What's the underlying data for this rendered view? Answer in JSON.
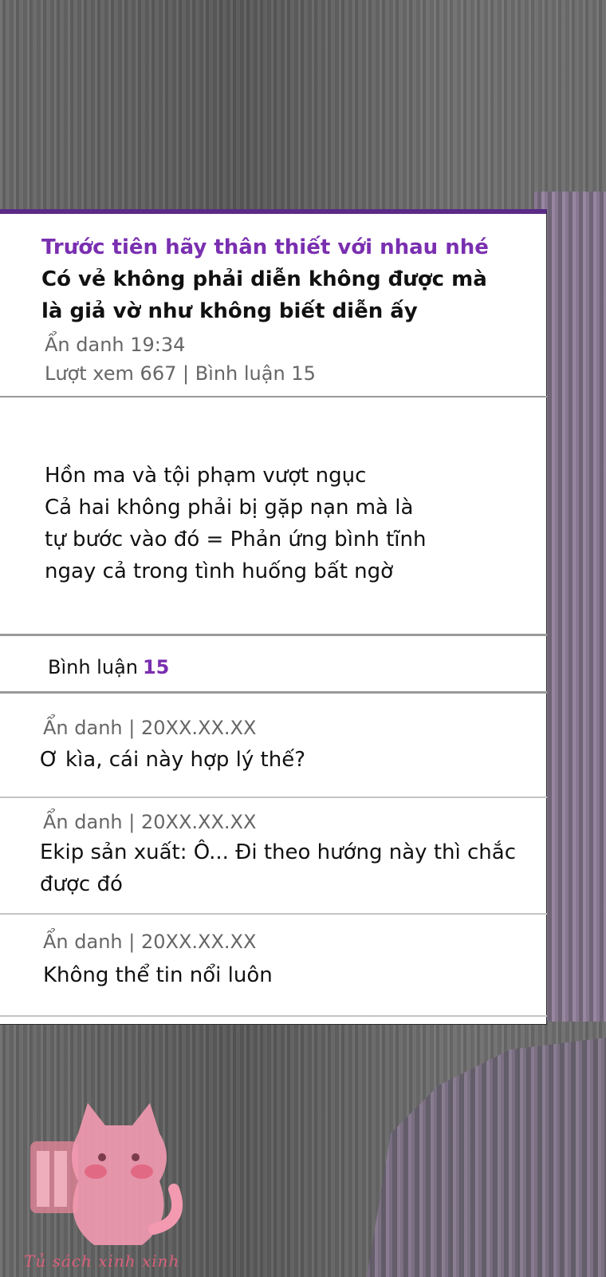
{
  "post": {
    "title_highlight": "Trước tiên hãy thân thiết với nhau nhé",
    "title_rest": " Có vẻ không phải diễn không được mà là giả vờ như không biết diễn ấy",
    "author_time": "Ẩn danh 19:34",
    "stats": "Lượt xem 667 | Bình luận 15",
    "body_lines": [
      "Hồn ma và tội phạm vượt ngục",
      "Cả hai không phải bị gặp nạn mà là",
      "tự bước vào đó = Phản ứng bình tĩnh",
      "ngay cả trong tình huống bất ngờ"
    ]
  },
  "comments": {
    "label": "Bình luận",
    "count": "15",
    "items": [
      {
        "meta": "Ẩn danh | 20XX.XX.XX",
        "text": "Ơ kìa, cái này hợp lý thế?"
      },
      {
        "meta": "Ẩn danh | 20XX.XX.XX",
        "text": "Ekip sản xuất: Ô... Đi theo hướng này thì chắc được đó"
      },
      {
        "meta": "Ẩn danh | 20XX.XX.XX",
        "text": "Không thể tin nổi luôn"
      }
    ]
  },
  "watermark": {
    "text": "Tủ sách xinh xinh"
  },
  "colors": {
    "accent": "#7a2fb0",
    "header_bar": "#5b2a86",
    "watermark": "#e0708a"
  }
}
